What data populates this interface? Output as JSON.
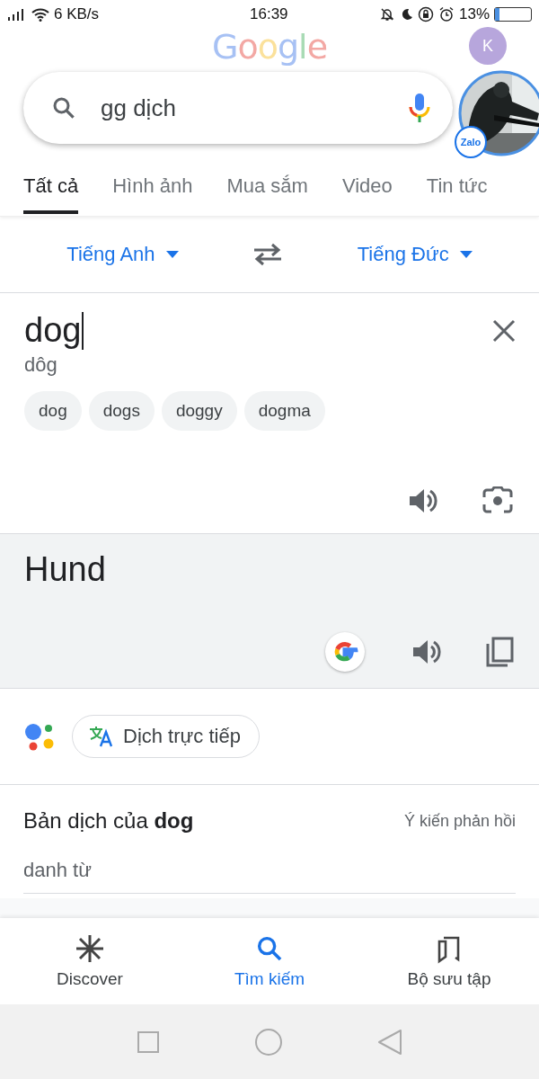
{
  "status_bar": {
    "network": "6 KB/s",
    "time": "16:39",
    "battery": "13%"
  },
  "logo": {
    "letters": [
      "G",
      "o",
      "o",
      "g",
      "l",
      "e"
    ]
  },
  "avatar": {
    "initial": "K"
  },
  "search": {
    "value": "gg dịch"
  },
  "zalo_bubble": {
    "label": "Zalo",
    "kind": "picture"
  },
  "tabs": [
    {
      "label": "Tất cả",
      "selected": true
    },
    {
      "label": "Hình ảnh",
      "selected": false
    },
    {
      "label": "Mua sắm",
      "selected": false
    },
    {
      "label": "Video",
      "selected": false
    },
    {
      "label": "Tin tức",
      "selected": false
    }
  ],
  "languages": {
    "source": "Tiếng Anh",
    "target": "Tiếng Đức"
  },
  "input": {
    "text": "dog",
    "transliteration": "dôg",
    "suggestions": [
      "dog",
      "dogs",
      "doggy",
      "dogma"
    ]
  },
  "output": {
    "text": "Hund"
  },
  "live_translate": {
    "label": "Dịch trực tiếp"
  },
  "translations": {
    "title": "Bản dịch của **dog**",
    "feedback": "Ý kiến phản hồi",
    "part_of_speech": "danh từ"
  },
  "bottom_nav": [
    {
      "label": "Discover",
      "kind": "discover",
      "selected": false
    },
    {
      "label": "Tìm kiếm",
      "kind": "search",
      "selected": true
    },
    {
      "label": "Bộ sưu tập",
      "kind": "collections",
      "selected": false
    }
  ]
}
